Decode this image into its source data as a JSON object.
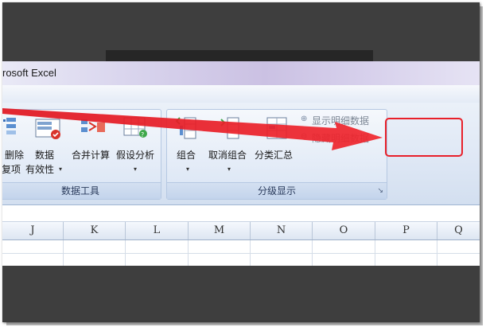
{
  "window": {
    "title": "rosoft Excel"
  },
  "ribbon": {
    "data_tools": {
      "label": "数据工具",
      "buttons": [
        {
          "label_line1": "删除",
          "label_line2": "重复项"
        },
        {
          "label_line1": "数据",
          "label_line2": "有效性",
          "dropdown": "▾"
        },
        {
          "label": "合并计算"
        },
        {
          "label": "假设分析",
          "dropdown": "▾"
        }
      ]
    },
    "outline": {
      "label": "分级显示",
      "buttons": [
        {
          "label": "组合",
          "dropdown": "▾"
        },
        {
          "label": "取消组合",
          "dropdown": "▾"
        },
        {
          "label": "分类汇总"
        }
      ],
      "show_detail": "显示明细数据",
      "hide_detail": "隐藏明细数据",
      "launcher": "↘"
    }
  },
  "sheet": {
    "columns": [
      "J",
      "K",
      "L",
      "M",
      "N",
      "O",
      "P",
      "Q"
    ]
  },
  "colors": {
    "annotation": "#e8202a",
    "ribbon_border": "#b5c8e2",
    "frame_bg": "#3e3e3e"
  }
}
